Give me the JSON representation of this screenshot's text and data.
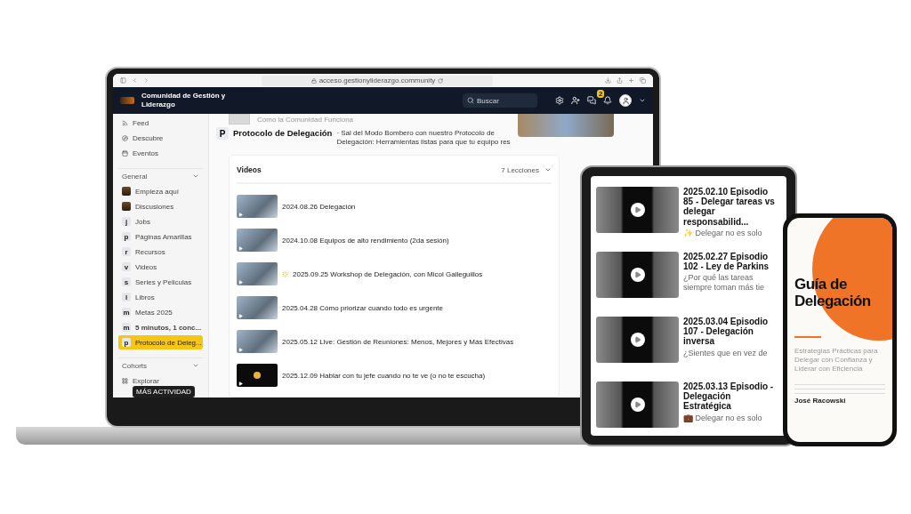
{
  "browser": {
    "url": "acceso.gestionyliderazgo.community"
  },
  "header": {
    "community_name": "Comunidad de Gestión y Liderazgo",
    "search": {
      "placeholder": "Buscar"
    },
    "notification_count": "2"
  },
  "sidebar": {
    "top_items": [
      {
        "label": "Feed",
        "kind": "feed"
      },
      {
        "label": "Descubre",
        "kind": "discover"
      },
      {
        "label": "Eventos",
        "kind": "calendar"
      }
    ],
    "groups": [
      {
        "title": "General",
        "expanded": true,
        "items": [
          {
            "label": "Empieza aquí",
            "kind": "avatar",
            "selected": false,
            "unread": false
          },
          {
            "label": "Discusiones",
            "kind": "avatar",
            "selected": false,
            "unread": false
          },
          {
            "label": "Jobs",
            "kind": "letter",
            "letter": "j",
            "selected": false,
            "unread": false
          },
          {
            "label": "Páginas Amarillas",
            "kind": "letter",
            "letter": "p",
            "selected": false,
            "unread": false
          },
          {
            "label": "Recursos",
            "kind": "letter",
            "letter": "r",
            "selected": false,
            "unread": false
          },
          {
            "label": "Videos",
            "kind": "letter",
            "letter": "v",
            "selected": false,
            "unread": false
          },
          {
            "label": "Series y Peliculas",
            "kind": "letter",
            "letter": "s",
            "selected": false,
            "unread": false
          },
          {
            "label": "Libros",
            "kind": "letter",
            "letter": "l",
            "selected": false,
            "unread": false
          },
          {
            "label": "Metas 2025",
            "kind": "letter",
            "letter": "m",
            "selected": false,
            "unread": false
          },
          {
            "label": "5 minutos, 1 conc...",
            "kind": "letter",
            "letter": "m",
            "selected": false,
            "unread": true
          },
          {
            "label": "Protocolo de Deleg...",
            "kind": "letter",
            "letter": "p",
            "selected": true,
            "unread": false
          }
        ]
      },
      {
        "title": "Cohorts",
        "expanded": true,
        "items": [
          {
            "label": "Explorar",
            "kind": "grid",
            "selected": false,
            "unread": false
          }
        ]
      }
    ],
    "tooltip": "MÁS ACTIVIDAD"
  },
  "page": {
    "previous_card": "Como la Comunidad Funciona",
    "space_letter": "P",
    "title": "Protocolo de Delegación",
    "description": "· Sal del Modo Bombero con nuestro Protocolo de Delegación: Herramientas listas para que tu equipo res",
    "section": {
      "title": "Videos",
      "count": "7 Lecciones",
      "expanded": true,
      "lessons": [
        {
          "title": "2024.08.26 Delegación",
          "in_progress": false,
          "kind": "photo"
        },
        {
          "title": "2024.10.08 Equipos de alto rendimiento (2da sesión)",
          "in_progress": false,
          "kind": "photo"
        },
        {
          "title": "2025.09.25 Workshop de Delegación, con Micol Galleguillos",
          "in_progress": true,
          "kind": "photo"
        },
        {
          "title": "2025.04.28 Cómo priorizar cuando todo es urgente",
          "in_progress": false,
          "kind": "photo"
        },
        {
          "title": "2025.05.12 Live: Gestión de Reuniones: Menos, Mejores y Más Efectivas",
          "in_progress": false,
          "kind": "photo"
        },
        {
          "title": "2025.12.09 Hablar con tu jefe cuando no te ve (o no te escucha)",
          "in_progress": false,
          "kind": "dark"
        }
      ]
    }
  },
  "tablet": {
    "episodes": [
      {
        "title": "2025.02.10 Episodio 85 - Delegar tareas vs delegar responsabilid...",
        "excerpt": "✨ Delegar no es solo"
      },
      {
        "title": "2025.02.27 Episodio 102 - Ley de Parkins",
        "excerpt": "¿Por qué las tareas siempre toman más tie"
      },
      {
        "title": "2025.03.04 Episodio 107 - Delegación inversa",
        "excerpt": "¿Sientes que en vez de"
      },
      {
        "title": "2025.03.13 Episodio - Delegación Estratégica",
        "excerpt": "💼 Delegar no es solo"
      }
    ]
  },
  "phone": {
    "title": "Guía de Delegación",
    "subtitle": "Estrategias Prácticas para Delegar con Confianza y Liderar con Eficiencia",
    "author": "José Racowski"
  }
}
